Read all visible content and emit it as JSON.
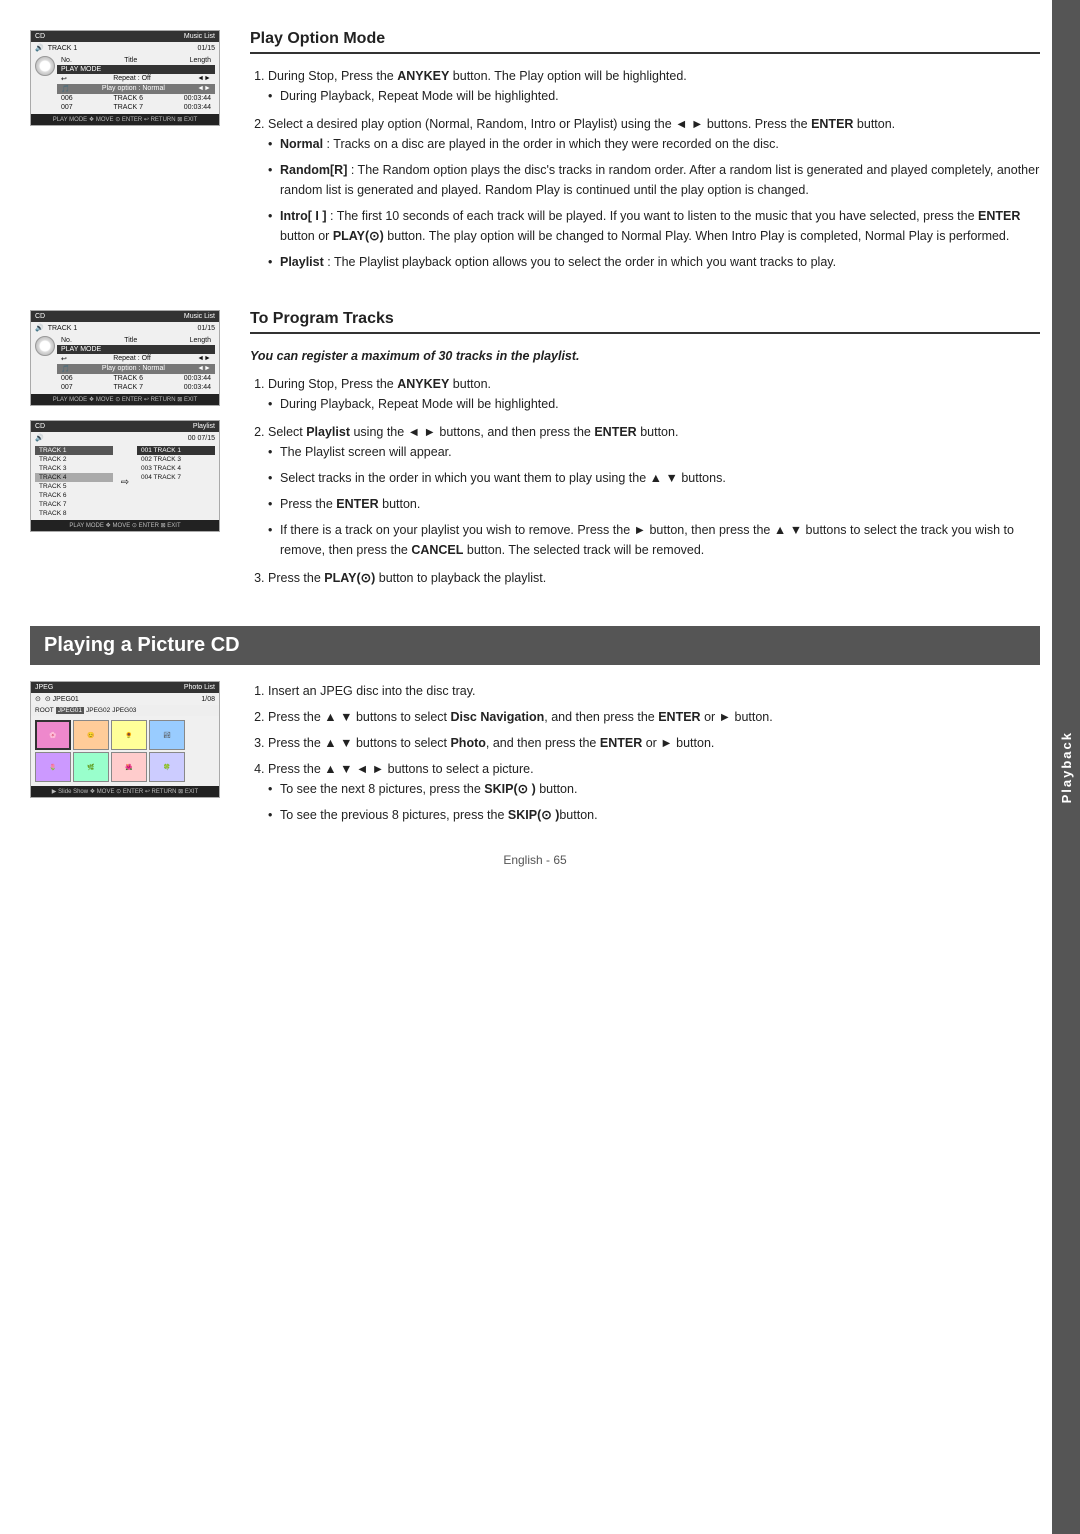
{
  "side_tab": "Playback",
  "sections": [
    {
      "id": "play-option-mode",
      "title": "Play Option Mode",
      "steps": [
        {
          "num": 1,
          "text": "During Stop, Press the <b>ANYKEY</b> button. The Play option will be highlighted.",
          "sub": [
            "During Playback, Repeat Mode will be highlighted."
          ]
        },
        {
          "num": 2,
          "text": "Select a desired play option (Normal, Random, Intro or Playlist) using the ◄ ► buttons. Press the <b>ENTER</b> button.",
          "sub": [
            "<b>Normal</b> : Tracks on a disc are played in the order in which they were recorded on the disc.",
            "<b>Random[R]</b> : The Random option plays the disc's tracks in random order. After a random list is generated and played completely, another random list is generated and played. Random Play is continued until the play option is changed.",
            "<b>Intro[ I ]</b> : The first 10 seconds of each track will be played. If you want to listen to the music that you have selected, press the <b>ENTER</b> button or <b>PLAY(⊙)</b> button. The play option will be changed to Normal Play. When Intro Play is completed, Normal Play is performed.",
            "<b>Playlist</b> : The Playlist playback option allows you to select the order in which you want tracks to play."
          ]
        }
      ]
    },
    {
      "id": "to-program-tracks",
      "title": "To Program Tracks",
      "italic_note": "You can register a maximum of 30 tracks in the playlist.",
      "steps": [
        {
          "num": 1,
          "text": "During Stop, Press the <b>ANYKEY</b> button.",
          "sub": [
            "During Playback, Repeat Mode will be highlighted."
          ]
        },
        {
          "num": 2,
          "text": "Select <b>Playlist</b> using the ◄ ► buttons, and then press the <b>ENTER</b> button.",
          "sub": [
            "The Playlist screen will appear.",
            "Select tracks in the order in which you want them to play using the ▲ ▼ buttons.",
            "Press the <b>ENTER</b> button.",
            "If there is a track on your playlist you wish to remove. Press the ► button, then press the ▲ ▼ buttons to select the track you wish to remove, then press the <b>CANCEL</b> button. The selected track will be removed."
          ]
        },
        {
          "num": 3,
          "text": "Press the <b>PLAY(⊙)</b> button to playback the playlist."
        }
      ]
    }
  ],
  "picture_cd": {
    "title": "Playing a Picture CD",
    "steps": [
      {
        "num": 1,
        "text": "Insert an JPEG disc into the disc tray."
      },
      {
        "num": 2,
        "text": "Press the ▲ ▼ buttons to select <b>Disc Navigation</b>, and then press the <b>ENTER</b> or ► button."
      },
      {
        "num": 3,
        "text": "Press the ▲ ▼ buttons to select <b>Photo</b>, and then press the <b>ENTER</b> or ► button."
      },
      {
        "num": 4,
        "text": "Press the ▲ ▼ ◄ ► buttons to select a picture.",
        "sub": [
          "To see the next 8 pictures, press the <b>SKIP(⊙)</b> button.",
          "To see the previous 8 pictures, press the <b>SKIP(⊙)</b> button."
        ]
      }
    ]
  },
  "footer": {
    "text": "English - 65"
  },
  "screens": {
    "play_option": {
      "header_left": "CD",
      "header_right": "Music List",
      "track": "TRACK 1",
      "track_num": "01/15",
      "columns": [
        "No.",
        "Title",
        "Length"
      ],
      "play_mode_label": "PLAY MODE",
      "repeat_label": "Repeat : Off",
      "play_option_label": "Play option : Normal",
      "tracks": [
        {
          "no": "006",
          "title": "TRACK 6",
          "length": "00:03:44"
        },
        {
          "no": "007",
          "title": "TRACK 7",
          "length": "00:03:44"
        }
      ],
      "footer": "PLAY MODE  ❖ MOVE  ⊙ ENTER  ↩ RETURN  ⊠ EXIT"
    },
    "playlist_top": {
      "header_left": "CD",
      "header_right": "Music List",
      "track": "TRACK 1",
      "track_num": "01/15",
      "play_mode_label": "PLAY MODE",
      "repeat_label": "Repeat : Off",
      "play_option_label": "Play option : Normal",
      "tracks": [
        {
          "no": "006",
          "title": "TRACK 6",
          "length": "00:03:44"
        },
        {
          "no": "007",
          "title": "TRACK 7",
          "length": "00:03:44"
        }
      ],
      "footer": "PLAY MODE  ❖ MOVE  ⊙ ENTER  ↩ RETURN  ⊠ EXIT"
    },
    "playlist_bottom": {
      "header_left": "CD",
      "header_right": "Playlist",
      "track": "",
      "track_num": "00 07/15",
      "left_tracks": [
        "TRACK 1",
        "TRACK 2",
        "TRACK 3",
        "TRACK 4",
        "TRACK 5",
        "TRACK 6",
        "TRACK 7",
        "TRACK 8"
      ],
      "right_tracks": [
        "001 TRACK 1",
        "002 TRACK 3",
        "003 TRACK 4",
        "004 TRACK 7"
      ],
      "footer": "PLAY MODE  ❖ MOVE  ⊙ ENTER          ⊠ EXIT"
    },
    "photo": {
      "header_left": "JPEG",
      "header_right": "Photo List",
      "track": "⊙ JPEG01",
      "track_num": "1/08",
      "folders": [
        "ROOT",
        "JPEG01",
        "JPEG02",
        "JPEG03"
      ],
      "thumbnails": [
        "flower",
        "face",
        "sunflower",
        "landscape",
        "flower2",
        "image5",
        "image6",
        "image7"
      ],
      "footer": "▶ Slide Show  ❖ MOVE  ⊙ ENTER  ↩ RETURN  ⊠ EXIT"
    }
  }
}
